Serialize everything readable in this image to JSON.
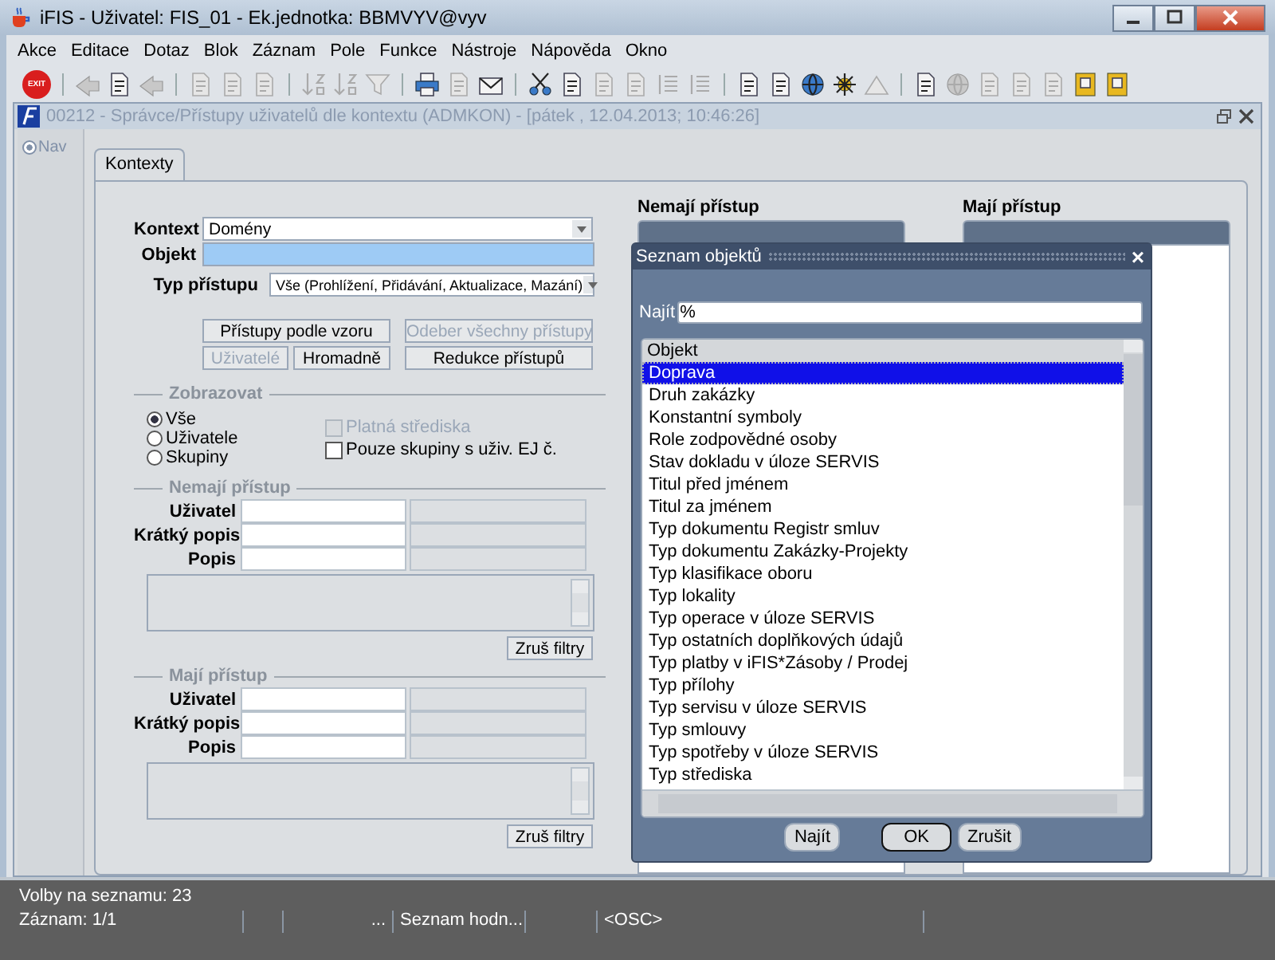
{
  "window": {
    "title": "iFIS - Uživatel: FIS_01 - Ek.jednotka: BBMVYV@vyv"
  },
  "menu": [
    "Akce",
    "Editace",
    "Dotaz",
    "Blok",
    "Záznam",
    "Pole",
    "Funkce",
    "Nástroje",
    "Nápověda",
    "Okno"
  ],
  "toolbar": [
    {
      "kind": "exit",
      "label": "EXIT"
    },
    {
      "kind": "separator"
    },
    {
      "kind": "tool",
      "disabled": true
    },
    {
      "kind": "tool",
      "disabled": false
    },
    {
      "kind": "tool",
      "disabled": true
    },
    {
      "kind": "separator"
    },
    {
      "kind": "tool",
      "disabled": true
    },
    {
      "kind": "tool",
      "disabled": true
    },
    {
      "kind": "tool",
      "disabled": true
    },
    {
      "kind": "separator"
    },
    {
      "kind": "tool",
      "disabled": true
    },
    {
      "kind": "tool",
      "disabled": true
    },
    {
      "kind": "tool",
      "disabled": true
    },
    {
      "kind": "separator"
    },
    {
      "kind": "tool",
      "disabled": false
    },
    {
      "kind": "tool",
      "disabled": true
    },
    {
      "kind": "tool",
      "disabled": false
    },
    {
      "kind": "separator"
    },
    {
      "kind": "tool",
      "disabled": false
    },
    {
      "kind": "tool",
      "disabled": false
    },
    {
      "kind": "tool",
      "disabled": true
    },
    {
      "kind": "tool",
      "disabled": true
    },
    {
      "kind": "tool",
      "disabled": true
    },
    {
      "kind": "tool",
      "disabled": true
    },
    {
      "kind": "separator"
    },
    {
      "kind": "tool",
      "disabled": false
    },
    {
      "kind": "tool",
      "disabled": false
    },
    {
      "kind": "tool",
      "disabled": false
    },
    {
      "kind": "tool",
      "disabled": false
    },
    {
      "kind": "tool",
      "disabled": true
    },
    {
      "kind": "separator"
    },
    {
      "kind": "tool",
      "disabled": false
    },
    {
      "kind": "tool",
      "disabled": true
    },
    {
      "kind": "tool",
      "disabled": true
    },
    {
      "kind": "tool",
      "disabled": true
    },
    {
      "kind": "tool",
      "disabled": true
    },
    {
      "kind": "tool",
      "disabled": false
    },
    {
      "kind": "tool",
      "disabled": false
    }
  ],
  "form_window": {
    "title": "00212 - Správce/Přístupy uživatelů dle kontextu (ADMKON) - [pátek , 12.04.2013; 10:46:26]"
  },
  "nav": {
    "label": "Nav"
  },
  "tabs": [
    {
      "label": "Kontexty",
      "selected": true
    }
  ],
  "kontext": {
    "label": "Kontext",
    "value": "Domény"
  },
  "objekt": {
    "label": "Objekt"
  },
  "typ_pristupu": {
    "label": "Typ přístupu",
    "value": "Vše (Prohlížení, Přidávání, Aktualizace, Mazání)"
  },
  "buttons": [
    {
      "label": "Přístupy podle vzoru",
      "disabled": false
    },
    {
      "label": "Odeber všechny přístupy",
      "disabled": true
    },
    {
      "label": "Uživatelé",
      "disabled": true
    },
    {
      "label": "Hromadně",
      "disabled": false
    },
    {
      "label": "Redukce přístupů",
      "disabled": false
    }
  ],
  "zobrazovat": {
    "title": "Zobrazovat",
    "radios": [
      {
        "label": "Vše",
        "selected": true
      },
      {
        "label": "Uživatele",
        "selected": false
      },
      {
        "label": "Skupiny",
        "selected": false
      }
    ],
    "checkboxes": [
      {
        "label": "Platná střediska",
        "checked": false,
        "disabled": true
      },
      {
        "label": "Pouze skupiny s uživ. EJ č.",
        "checked": false,
        "disabled": false
      }
    ]
  },
  "filters": [
    {
      "title": "Nemají přístup",
      "fields": [
        "Uživatel",
        "Krátký popis",
        "Popis"
      ],
      "button": "Zruš filtry"
    },
    {
      "title": "Mají přístup",
      "fields": [
        "Uživatel",
        "Krátký popis",
        "Popis"
      ],
      "button": "Zruš filtry"
    }
  ],
  "lists": [
    {
      "title": "Nemají přístup"
    },
    {
      "title": "Mají přístup"
    }
  ],
  "dialog": {
    "title": "Seznam objektů",
    "close": "×",
    "find_label": "Najít",
    "find_value": "%",
    "column": "Objekt",
    "rows": [
      {
        "label": "Doprava",
        "selected": true
      },
      {
        "label": "Druh zakázky",
        "selected": false
      },
      {
        "label": "Konstantní symboly",
        "selected": false
      },
      {
        "label": "Role zodpovědné osoby",
        "selected": false
      },
      {
        "label": "Stav dokladu v úloze SERVIS",
        "selected": false
      },
      {
        "label": "Titul před jménem",
        "selected": false
      },
      {
        "label": "Titul za jménem",
        "selected": false
      },
      {
        "label": "Typ dokumentu Registr smluv",
        "selected": false
      },
      {
        "label": "Typ dokumentu Zakázky-Projekty",
        "selected": false
      },
      {
        "label": "Typ klasifikace oboru",
        "selected": false
      },
      {
        "label": "Typ lokality",
        "selected": false
      },
      {
        "label": "Typ operace v úloze SERVIS",
        "selected": false
      },
      {
        "label": "Typ ostatních doplňkových údajů",
        "selected": false
      },
      {
        "label": "Typ platby v iFIS*Zásoby / Prodej",
        "selected": false
      },
      {
        "label": "Typ přílohy",
        "selected": false
      },
      {
        "label": "Typ servisu v úloze SERVIS",
        "selected": false
      },
      {
        "label": "Typ smlouvy",
        "selected": false
      },
      {
        "label": "Typ spotřeby v úloze SERVIS",
        "selected": false
      },
      {
        "label": "Typ střediska",
        "selected": false
      }
    ],
    "buttons": [
      {
        "label": "Najít",
        "selected": false
      },
      {
        "label": "OK",
        "selected": true
      },
      {
        "label": "Zrušit",
        "selected": false
      }
    ]
  },
  "status_bar": {
    "message": "Volby na seznamu: 23",
    "cells": [
      "Záznam: 1/1",
      "",
      "...",
      "Seznam hodn...",
      "",
      "<OSC>"
    ]
  }
}
